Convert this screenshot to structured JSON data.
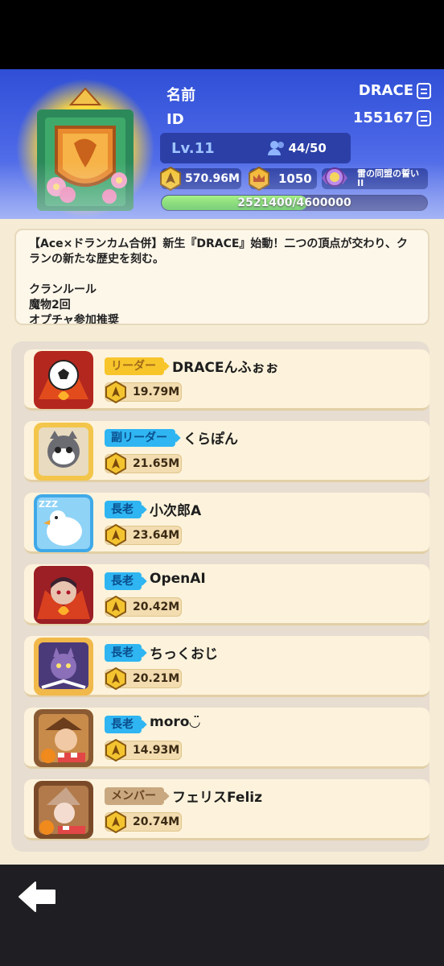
{
  "header": {
    "name_label": "名前",
    "id_label": "ID",
    "clan_name": "DRACE",
    "clan_id": "155167",
    "level": "Lv.11",
    "members": "44/50",
    "power": "570.96M",
    "crowns": "1050",
    "oath_label": "雷の同盟の誓い II",
    "xp_text": "2521400/4600000",
    "xp_fraction": 0.548
  },
  "description": {
    "text": "【Ace×ドランカム合併】新生『DRACE』始動！二つの頂点が交わり、クランの新たな歴史を刻む。\n\nクランルール\n魔物2回\nオプチャ参加推奨"
  },
  "members": [
    {
      "role": "リーダー",
      "role_type": "leader",
      "name": "DRACEんふぉぉ",
      "power": "19.79M",
      "avatar": "soccer-avatar"
    },
    {
      "role": "副リーダー",
      "role_type": "sub",
      "name": "くらぽん",
      "power": "21.65M",
      "avatar": "raccoon-avatar"
    },
    {
      "role": "長老",
      "role_type": "elder",
      "name": "小次郎A",
      "power": "23.64M",
      "avatar": "penguin-avatar"
    },
    {
      "role": "長老",
      "role_type": "elder",
      "name": "OpenAI",
      "power": "20.42M",
      "avatar": "vampire-avatar"
    },
    {
      "role": "長老",
      "role_type": "elder",
      "name": "ちっくおじ",
      "power": "20.21M",
      "avatar": "cat-avatar"
    },
    {
      "role": "長老",
      "role_type": "elder",
      "name": "moro◡̈",
      "power": "14.93M",
      "avatar": "farmer-avatar"
    },
    {
      "role": "メンバー",
      "role_type": "member",
      "name": "フェリスFeliz",
      "power": "20.74M",
      "avatar": "witch-avatar"
    }
  ],
  "colors": {
    "header_blue": "#3a58dc",
    "panel_bg": "#f6ecd6",
    "leader_tag": "#f7c52a",
    "elder_tag": "#2fb5f2",
    "member_tag": "#c9a880",
    "xp_green": "#5fd93d"
  }
}
